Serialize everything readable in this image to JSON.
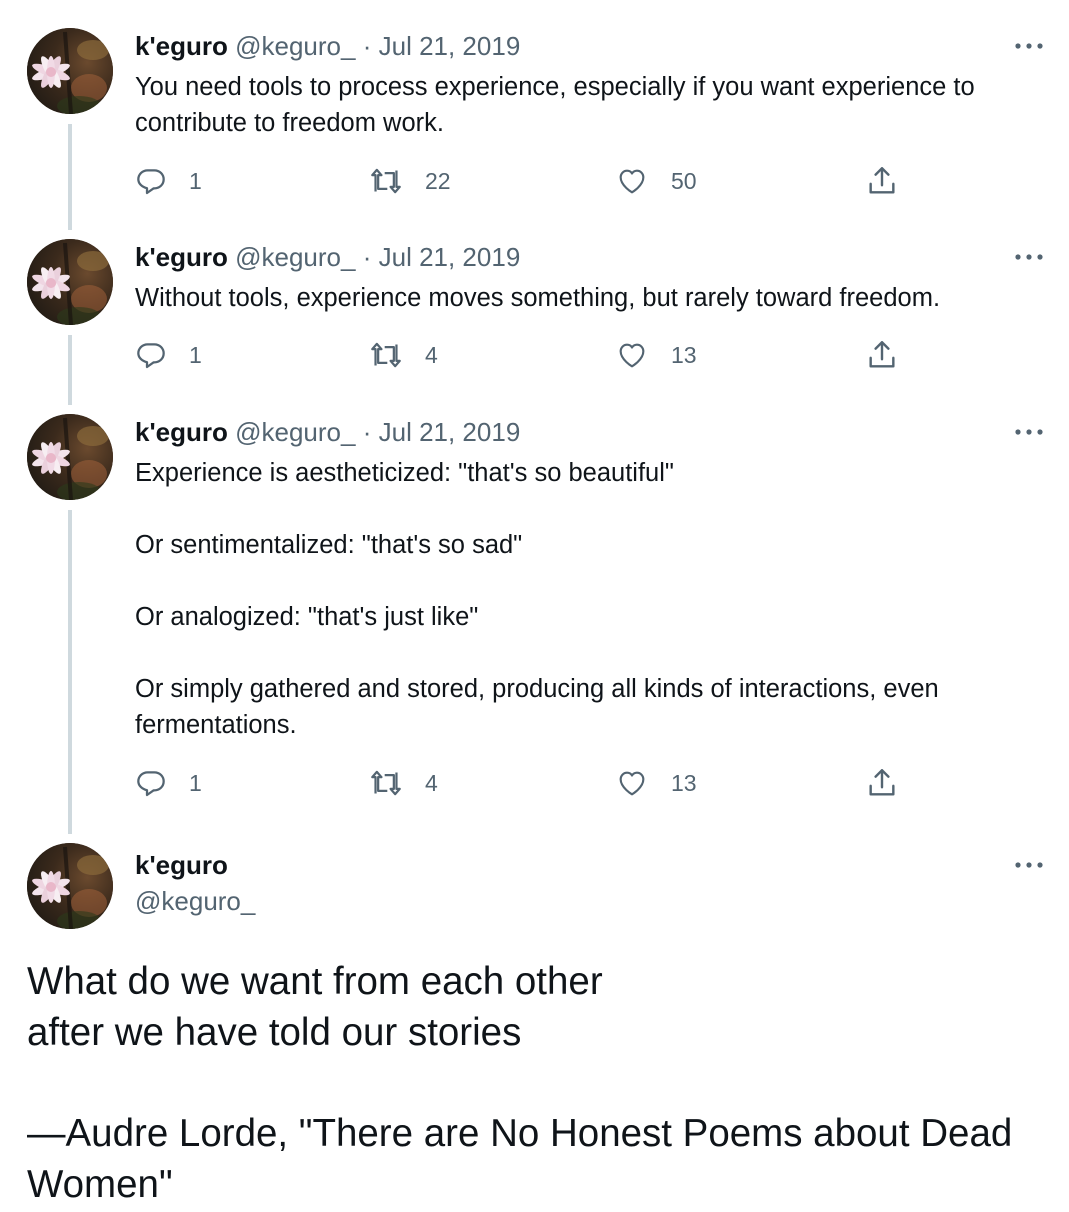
{
  "tweets": [
    {
      "name": "k'eguro",
      "handle": "@keguro_",
      "date": "Jul 21, 2019",
      "paragraphs": [
        "You need tools to process experience, especially if you want experience to contribute to freedom work."
      ],
      "replies": "1",
      "retweets": "22",
      "likes": "50"
    },
    {
      "name": "k'eguro",
      "handle": "@keguro_",
      "date": "Jul 21, 2019",
      "paragraphs": [
        "Without tools, experience moves something, but rarely toward freedom."
      ],
      "replies": "1",
      "retweets": "4",
      "likes": "13"
    },
    {
      "name": "k'eguro",
      "handle": "@keguro_",
      "date": "Jul 21, 2019",
      "paragraphs": [
        "Experience is aestheticized: \"that's so beautiful\"",
        "Or sentimentalized: \"that's so sad\"",
        "Or analogized: \"that's just like\"",
        "Or simply gathered and stored, producing all kinds of interactions, even fermentations."
      ],
      "replies": "1",
      "retweets": "4",
      "likes": "13"
    }
  ],
  "main_tweet": {
    "name": "k'eguro",
    "handle": "@keguro_",
    "paragraphs": [
      "What do we want from each other after we have told our stories",
      "—Audre Lorde, \"There are No Honest Poems about Dead Women\""
    ]
  },
  "icons": {
    "more": "more-horizontal-icon",
    "reply": "reply-icon",
    "retweet": "retweet-icon",
    "like": "heart-icon",
    "share": "share-icon"
  },
  "colors": {
    "text": "#0f1419",
    "secondary": "#536471",
    "thread_line": "#cfd9de"
  }
}
